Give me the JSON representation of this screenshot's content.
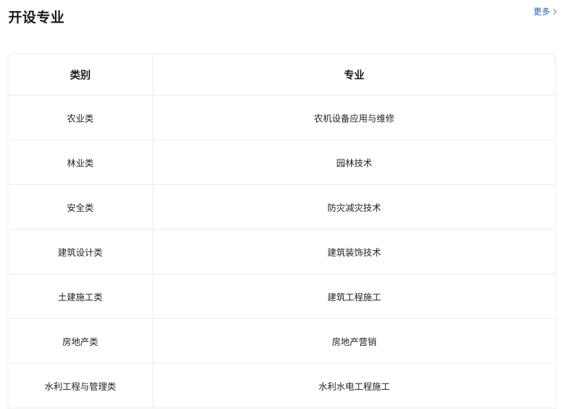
{
  "section": {
    "title": "开设专业",
    "more_label": "更多"
  },
  "table": {
    "headers": [
      "类别",
      "专业"
    ],
    "rows": [
      {
        "category": "农业类",
        "major": "农机设备应用与维修"
      },
      {
        "category": "林业类",
        "major": "园林技术"
      },
      {
        "category": "安全类",
        "major": "防灾减灾技术"
      },
      {
        "category": "建筑设计类",
        "major": "建筑装饰技术"
      },
      {
        "category": "土建施工类",
        "major": "建筑工程施工"
      },
      {
        "category": "房地产类",
        "major": "房地产营销"
      },
      {
        "category": "水利工程与管理类",
        "major": "水利水电工程施工"
      }
    ]
  },
  "icons": {
    "more": "chevron-right-icon"
  },
  "colors": {
    "link": "#2a5caa",
    "border": "#ececec",
    "text": "#222222"
  }
}
